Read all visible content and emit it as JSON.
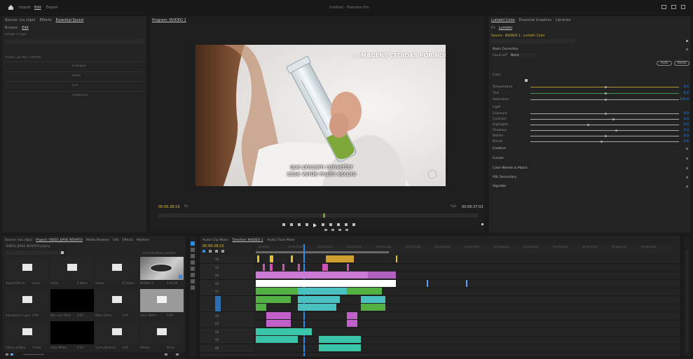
{
  "app": {
    "title": "Untitled - Premiere Pro",
    "workspace_tabs": [
      "Import",
      "Edit",
      "Export"
    ],
    "active_workspace": "Edit"
  },
  "left_panel": {
    "tabs": [
      "Source: (no clips)",
      "Effects",
      "Essential Sound"
    ],
    "subtabs": [
      "Browse",
      "Edit"
    ],
    "rows": [
      "Assign a Type",
      "Audio Clip Mix / Effects",
      "Dialogue",
      "Music",
      "SFX",
      "Ambience"
    ]
  },
  "program_monitor": {
    "tab": "Program: NVIDEO 1",
    "watermark": "IMAGENS CEDIDAS POR NORCE",
    "subtitle_line1": "que possam converter",
    "subtitle_line2": "esse verde muito escuro",
    "timecode_left": "00:00:28:10",
    "fit": "Fit",
    "quality": "Full",
    "timecode_right": "00:06:37:02"
  },
  "lumetri": {
    "tabs": [
      "Lumetri Color",
      "Essential Graphics",
      "Libraries"
    ],
    "subtabs": [
      "Fx",
      "Lumetri"
    ],
    "source_path": "Source · NVIDEO 1 · Lumetri Color",
    "basic_correction": "Basic Correction",
    "input_lut": "Input LUT",
    "input_lut_value": "None",
    "auto_button": "Auto",
    "reset_button": "Reset",
    "color_section": "Color",
    "light_section": "Light",
    "sliders": [
      {
        "label": "Temperature",
        "value": "0.0",
        "pos": 0.5,
        "color": "#c8a23a"
      },
      {
        "label": "Tint",
        "value": "0.0",
        "pos": 0.5,
        "color": "#4aa35a"
      },
      {
        "label": "Saturation",
        "value": "100.0",
        "pos": 0.5,
        "color": "#b9b9b9"
      },
      {
        "label": "Exposure",
        "value": "0.0",
        "pos": 0.5,
        "color": "#b9b9b9"
      },
      {
        "label": "Contrast",
        "value": "0.0",
        "pos": 0.55,
        "color": "#b9b9b9"
      },
      {
        "label": "Highlights",
        "value": "0.0",
        "pos": 0.38,
        "color": "#b9b9b9"
      },
      {
        "label": "Shadows",
        "value": "0.0",
        "pos": 0.57,
        "color": "#b9b9b9"
      },
      {
        "label": "Whites",
        "value": "0.0",
        "pos": 0.5,
        "color": "#b9b9b9"
      },
      {
        "label": "Blacks",
        "value": "0.0",
        "pos": 0.47,
        "color": "#b9b9b9"
      }
    ],
    "sections": [
      "Creative",
      "Curves",
      "Color Wheels & Match",
      "HSL Secondary",
      "Vignette"
    ]
  },
  "project_panel": {
    "tabs": [
      "Source: (no clips)",
      "Project: VIDEO_BASE NOVATO",
      "Media Browser",
      "Info",
      "Effects",
      "Markers"
    ],
    "path": "VIDEO_BASE NOVATO.prproj",
    "count": "13 of 16 items selected",
    "items": [
      {
        "name": "Sound Effects",
        "meta": "Items"
      },
      {
        "name": "Audio",
        "meta": "4 Items"
      },
      {
        "name": "Vídeos",
        "meta": "25 Items"
      },
      {
        "name": "NVIDEO 1",
        "meta": "2:44:06"
      },
      {
        "name": "Adjustment Layer",
        "meta": "0:00"
      },
      {
        "name": "Bars and Tone",
        "meta": "0:05"
      },
      {
        "name": "Black Video",
        "meta": "0:00"
      },
      {
        "name": "Color Matte",
        "meta": "0:00"
      },
      {
        "name": "Clipes_antigos",
        "meta": "1 Item"
      },
      {
        "name": "Color Matte",
        "meta": "0:05"
      },
      {
        "name": "Cores_Neutras",
        "meta": "0:00"
      },
      {
        "name": "Efeitos",
        "meta": "Items"
      }
    ]
  },
  "timeline": {
    "tabs": [
      "Audio Clip Mixer",
      "Timeline: NVIDEO 1",
      "Audio Track Mixer"
    ],
    "active_tab": "NVIDEO 1",
    "timecode": "00:00:28:10",
    "ruler": [
      "00:00:00",
      "00:00:30:00",
      "00:01:00:00",
      "00:01:30:00",
      "00:02:00:00",
      "00:02:30:00",
      "00:03:00:00",
      "00:03:30:00",
      "00:04:00:00",
      "00:04:30:00",
      "00:05:00:00",
      "00:05:30:00",
      "00:06:00:00",
      "00:06:30:00"
    ],
    "tracks": [
      "V6",
      "V5",
      "V4",
      "V3",
      "V2",
      "V1",
      "A1",
      "A2",
      "A3",
      "A4",
      "A5",
      "A6"
    ],
    "video_clip_label": "Adjustment"
  }
}
